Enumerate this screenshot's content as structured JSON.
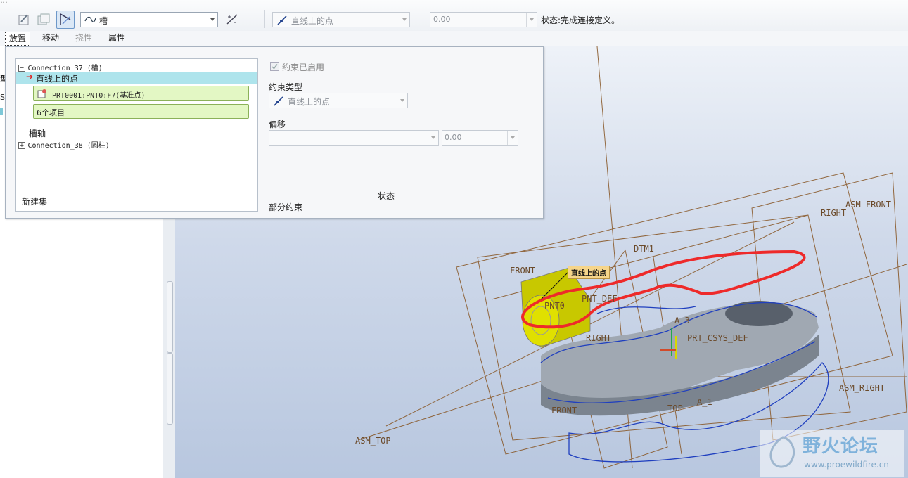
{
  "title_fragment": "...",
  "toolbar": {
    "constraint_set_value": "槽",
    "constraint_type_value": "直线上的点",
    "offset_value": "0.00",
    "status_text": "状态:完成连接定义。"
  },
  "tabs": [
    {
      "label": "放置",
      "state": "selected"
    },
    {
      "label": "移动",
      "state": "normal"
    },
    {
      "label": "挠性",
      "state": "disabled"
    },
    {
      "label": "属性",
      "state": "normal"
    }
  ],
  "tree": {
    "connection_37": "Connection_37 (槽)",
    "active_constraint": "直线上的点",
    "ref_1": "PRT0001:PNT0:F7(基准点)",
    "ref_2": "6个项目",
    "slot_axis": "槽轴",
    "connection_38": "Connection_38 (圆柱)",
    "new_set": "新建集"
  },
  "details": {
    "enabled_label": "约束已启用",
    "type_label": "约束类型",
    "type_value": "直线上的点",
    "offset_label": "偏移",
    "offset_value": "0.00",
    "status_header": "状态",
    "status_value": "部分约束"
  },
  "left_pane_fragments": [
    "型",
    "S"
  ],
  "viewport": {
    "labels": [
      "ASM_FRONT",
      "RIGHT",
      "DTM1",
      "FRONT",
      "PNT0",
      "PNT_DEF",
      "A_3",
      "RIGHT",
      "PRT_CSYS_DEF",
      "ASM_RIGHT",
      "TOP",
      "A_1",
      "FRONT",
      "ASM_TOP"
    ],
    "callout": "直线上的点"
  },
  "watermark": {
    "name": "野火论坛",
    "url": "www.proewildfire.cn"
  },
  "colors": {
    "highlight_row": "#aee4ec",
    "green_box": "#e3f7c4",
    "annotation_red": "#ee2a2a",
    "datum_brown": "#8a5a2b",
    "edge_blue": "#1f3fbf",
    "part_yellow": "#c8c800"
  }
}
